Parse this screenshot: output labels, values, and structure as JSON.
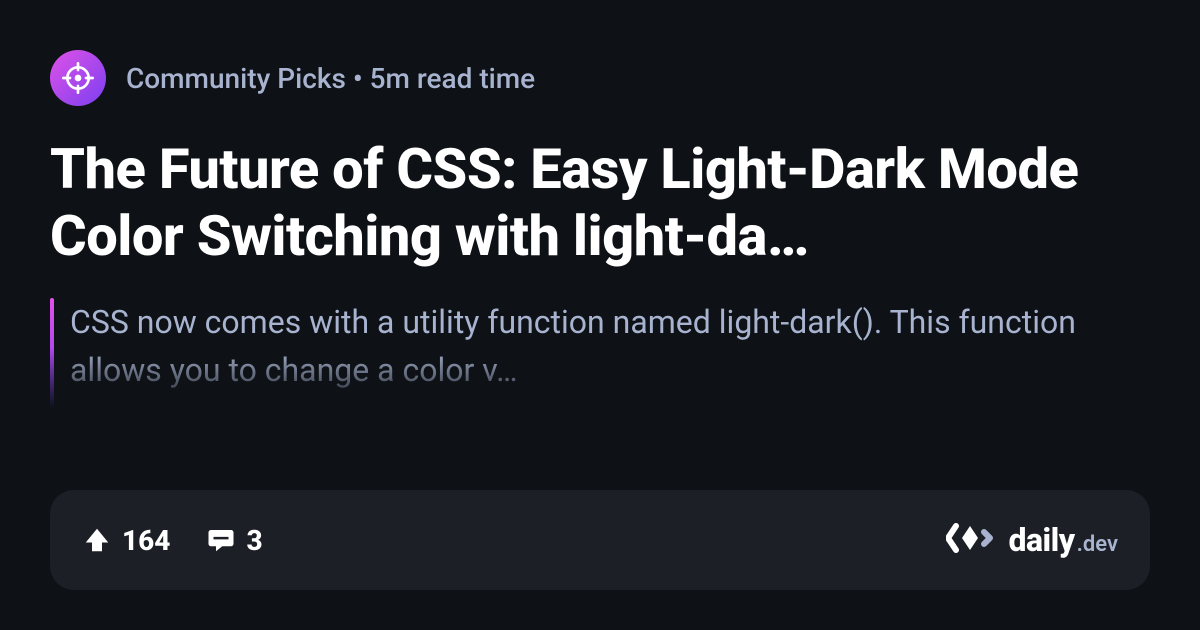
{
  "source": {
    "name": "Community Picks",
    "icon_name": "crosshair-icon"
  },
  "read_time": "5m read time",
  "separator": " • ",
  "title": "The Future of CSS: Easy Light-Dark Mode Color Switching with light-da…",
  "excerpt": "CSS now comes with a utility function named light-dark(). This function allows you to change a color v…",
  "stats": {
    "upvotes": "164",
    "comments": "3"
  },
  "brand": {
    "name_main": "daily",
    "name_suffix": ".dev"
  }
}
